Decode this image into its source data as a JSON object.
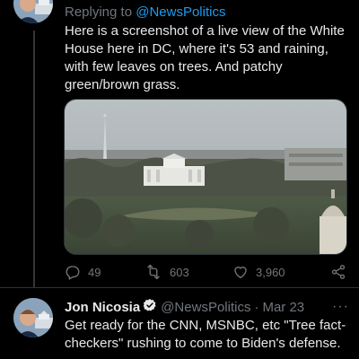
{
  "tweet1": {
    "reply_prefix": "Replying to ",
    "reply_handle": "@NewsPolitics",
    "text": "Here is a screenshot of a live view of the White House here in DC, where it's 53 and raining, with few leaves on trees. And patchy green/brown grass.",
    "reply_count": "49",
    "retweet_count": "603",
    "like_count": "3,960"
  },
  "tweet2": {
    "name": "Jon Nicosia",
    "handle": "@NewsPolitics",
    "separator": "·",
    "date": "Mar 23",
    "more": "···",
    "text": "Get ready for the CNN, MSNBC, etc \"Tree fact-checkers\" rushing to come to Biden's defense."
  },
  "colors": {
    "background": "#000000",
    "accent": "#1d9bf0",
    "secondary_text": "#71767b"
  }
}
